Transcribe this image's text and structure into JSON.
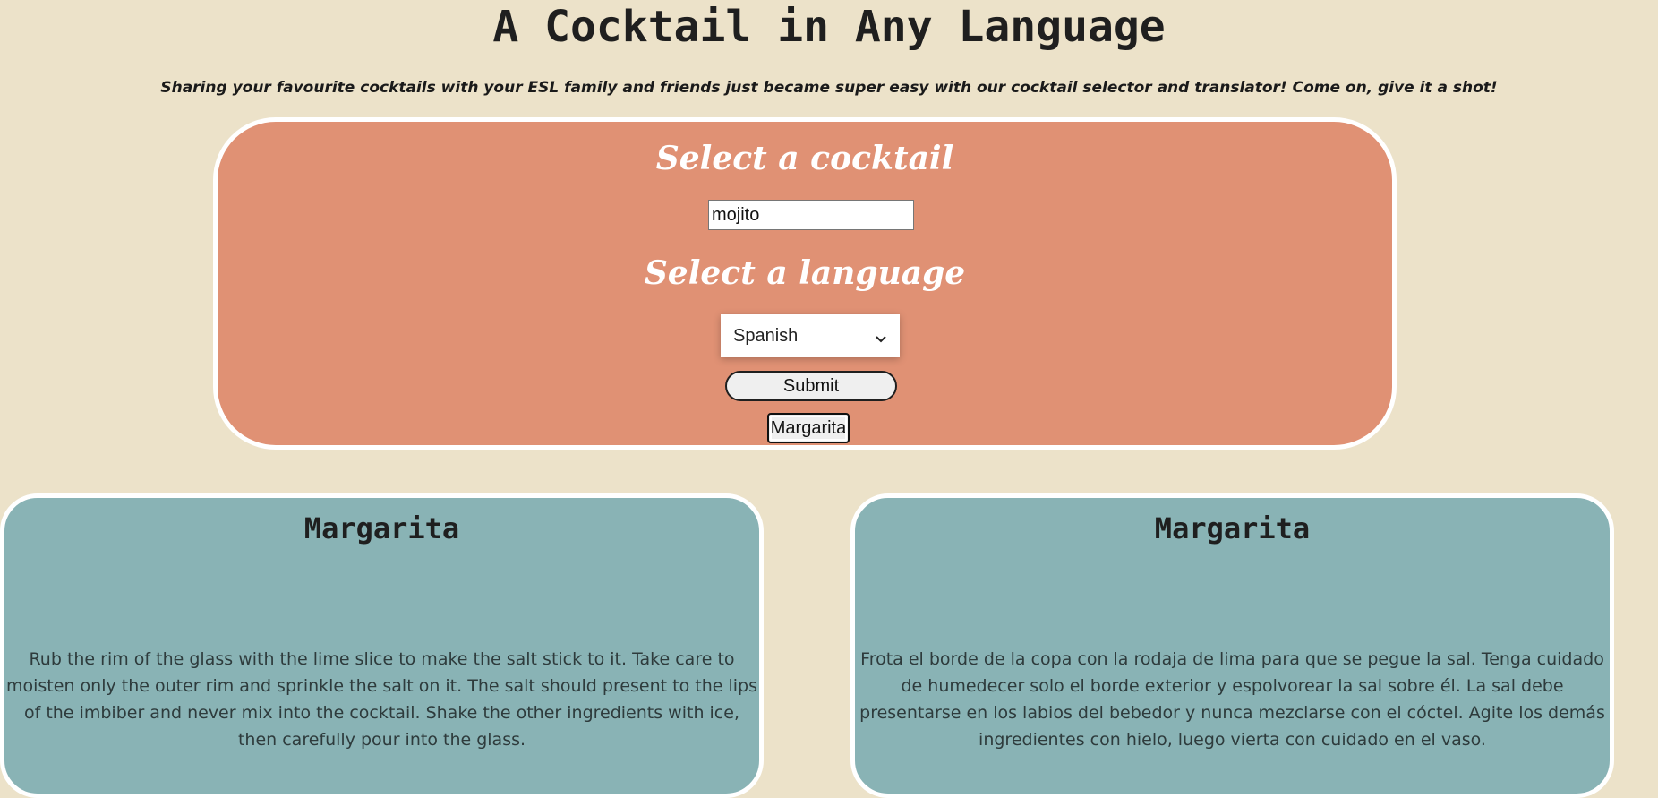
{
  "header": {
    "title": "A Cocktail in Any Language",
    "tagline": "Sharing your favourite cocktails with your ESL family and friends just became super easy with our cocktail selector and translator! Come on, give it a shot!"
  },
  "selector": {
    "cocktail_heading": "Select a cocktail",
    "cocktail_input_value": "mojito",
    "language_heading": "Select a language",
    "language_selected": "Spanish",
    "submit_label": "Submit",
    "history_button_label": "Margarita"
  },
  "cards": {
    "original": {
      "title": "Margarita",
      "instructions": "Rub the rim of the glass with the lime slice to make the salt stick to it. Take care to moisten only the outer rim and sprinkle the salt on it. The salt should present to the lips of the imbiber and never mix into the cocktail. Shake the other ingredients with ice, then carefully pour into the glass."
    },
    "translated": {
      "title": "Margarita",
      "instructions": "Frota el borde de la copa con la rodaja de lima para que se pegue la sal. Tenga cuidado de humedecer solo el borde exterior y espolvorear la sal sobre él. La sal debe presentarse en los labios del bebedor y nunca mezclarse con el cóctel. Agite los demás ingredientes con hielo, luego vierta con cuidado en el vaso."
    }
  },
  "colors": {
    "background": "#ece2c9",
    "selector_panel": "#e09174",
    "card": "#89b3b5",
    "border": "#ffffff"
  },
  "icons": {
    "select_arrow": "chevron-down-icon"
  }
}
